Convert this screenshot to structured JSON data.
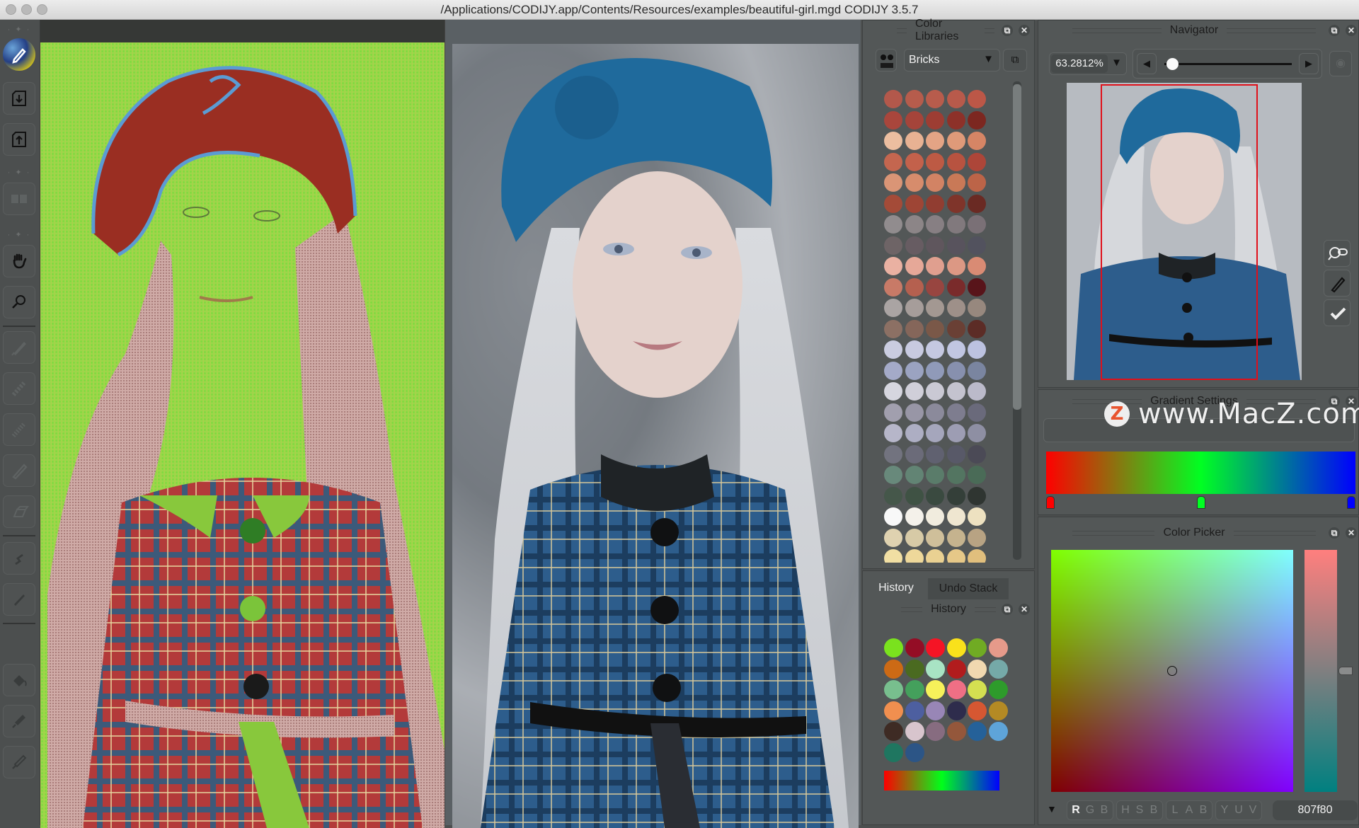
{
  "window": {
    "title": "/Applications/CODIJY.app/Contents/Resources/examples/beautiful-girl.mgd CODIJY 3.5.7"
  },
  "toolbar": {
    "tools": [
      {
        "name": "colorize-brush",
        "icon": "pen-palette-icon"
      },
      {
        "name": "import",
        "icon": "file-import-icon"
      },
      {
        "name": "export",
        "icon": "file-export-icon"
      },
      {
        "name": "compare-view",
        "icon": "split-view-icon"
      },
      {
        "name": "hand",
        "icon": "hand-icon"
      },
      {
        "name": "zoom",
        "icon": "magnifier-icon"
      },
      {
        "name": "marker",
        "icon": "marker-icon"
      },
      {
        "name": "dotted-marker",
        "icon": "dotted-marker-icon"
      },
      {
        "name": "pattern-marker",
        "icon": "pattern-marker-icon"
      },
      {
        "name": "pencil",
        "icon": "pencil-icon"
      },
      {
        "name": "eraser",
        "icon": "eraser-icon"
      },
      {
        "name": "freehand-line",
        "icon": "squiggle-icon"
      },
      {
        "name": "straight-line",
        "icon": "line-icon"
      },
      {
        "name": "fill",
        "icon": "bucket-icon"
      },
      {
        "name": "dropper",
        "icon": "dropper-icon"
      },
      {
        "name": "picker",
        "icon": "eyedropper-icon"
      }
    ]
  },
  "color_libraries": {
    "title": "Color Libraries",
    "selected_library": "Bricks",
    "swatch_rows": [
      [
        "#b3584b",
        "#b65c4c",
        "#b85c4c",
        "#b85a4b",
        "#bc5747"
      ],
      [
        "#a9463c",
        "#a5443a",
        "#9d3d33",
        "#8d3129",
        "#7c2720"
      ],
      [
        "#ecbea0",
        "#e8b293",
        "#e4a485",
        "#df9a79",
        "#d68565"
      ],
      [
        "#c4664f",
        "#c3614b",
        "#bd5a44",
        "#b85340",
        "#ad4639"
      ],
      [
        "#da9576",
        "#d78c6c",
        "#d28364",
        "#c97957",
        "#bc6448"
      ],
      [
        "#a44b38",
        "#9e4535",
        "#913d31",
        "#7f342a",
        "#6a2a23"
      ],
      [
        "#918c8e",
        "#8c8587",
        "#877f83",
        "#81797d",
        "#7a7076"
      ],
      [
        "#6e6466",
        "#675c62",
        "#5f565d",
        "#58535d",
        "#52525e"
      ],
      [
        "#eab1a2",
        "#e6a898",
        "#e09f8f",
        "#dc9884",
        "#d98b74"
      ],
      [
        "#c87a67",
        "#b5604f",
        "#984540",
        "#7a2b2b",
        "#58141a"
      ],
      [
        "#aaa4a3",
        "#a69d9a",
        "#a39892",
        "#9e9089",
        "#97887e"
      ],
      [
        "#8c7064",
        "#85665a",
        "#7a5848",
        "#6a4035",
        "#5c2c26"
      ],
      [
        "#cacce0",
        "#c8cae0",
        "#c5c8e1",
        "#c1c6e2",
        "#bcc2e0"
      ],
      [
        "#a4aac8",
        "#9ba3c1",
        "#909ab9",
        "#8790ae",
        "#7a85a0"
      ],
      [
        "#d6d6df",
        "#d0cfd9",
        "#cac9d4",
        "#c4c3cf",
        "#bbbaca"
      ],
      [
        "#a19fae",
        "#9896a6",
        "#8b8a9b",
        "#7e7d8f",
        "#6a6a7b"
      ],
      [
        "#b6b6c9",
        "#adaec3",
        "#a5a6bc",
        "#9d9db3",
        "#8e8fa3"
      ],
      [
        "#72737f",
        "#6b6b79",
        "#606170",
        "#585968",
        "#4b4a56"
      ],
      [
        "#68897b",
        "#628474",
        "#5a7c6a",
        "#537561",
        "#4a6b57"
      ],
      [
        "#45574a",
        "#3f5244",
        "#3a4a40",
        "#343f39",
        "#2f3531"
      ],
      [
        "#f8f8f8",
        "#f4f1ea",
        "#f1ecde",
        "#efe6d0",
        "#ede1c0"
      ],
      [
        "#dfd2b0",
        "#d7caa6",
        "#cfbf9a",
        "#c5b38e",
        "#b8a383"
      ],
      [
        "#f1dfa3",
        "#eed89a",
        "#ead192",
        "#e6c888",
        "#e1bf7d"
      ]
    ]
  },
  "history": {
    "tabs": [
      {
        "label": "History",
        "active": true
      },
      {
        "label": "Undo Stack",
        "active": false
      }
    ],
    "title": "History",
    "swatches": [
      "#7ae21e",
      "#940d25",
      "#f51425",
      "#f9e11b",
      "#70ab23",
      "#e69a8a",
      "#cc6a15",
      "#4a6a20",
      "#a8e3c4",
      "#b11c1d",
      "#f1d8b0",
      "#75a9a8",
      "#78bf8e",
      "#44a05c",
      "#f6f15a",
      "#ef6f85",
      "#d4df51",
      "#2e9b2b",
      "#f18f4f",
      "#4d5fa0",
      "#9886b6",
      "#2e2c4c",
      "#d65732",
      "#b48a24",
      "#3e2b24",
      "#d8c5cd",
      "#876c80",
      "#94573b",
      "#256199",
      "#5ea4d9",
      "#1f7660",
      "#2c5586"
    ],
    "gradient_stops": [
      "#ff0000",
      "#00ff1a",
      "#0000ff"
    ]
  },
  "navigator": {
    "title": "Navigator",
    "zoom_value": "63.2812%",
    "zoom_slider_fraction": 0.06
  },
  "gradient_settings": {
    "title": "Gradient Settings",
    "stops": [
      {
        "color": "#ff0000",
        "position": 0.0
      },
      {
        "color": "#00ff22",
        "position": 0.5
      },
      {
        "color": "#0000ff",
        "position": 1.0
      }
    ]
  },
  "color_picker": {
    "title": "Color Picker",
    "formats": [
      {
        "group": "rgb",
        "letters": [
          "R",
          "G",
          "B"
        ],
        "active_index": 0
      },
      {
        "group": "hsb",
        "letters": [
          "H",
          "S",
          "B"
        ],
        "active_index": -1
      },
      {
        "group": "lab",
        "letters": [
          "L",
          "A",
          "B"
        ],
        "active_index": -1
      },
      {
        "group": "yuv",
        "letters": [
          "Y",
          "U",
          "V"
        ],
        "active_index": -1
      }
    ],
    "hex_value": "807f80",
    "slider_fraction": 0.5
  },
  "watermark": {
    "logo_letter": "Z",
    "text": "www.MacZ.com"
  }
}
